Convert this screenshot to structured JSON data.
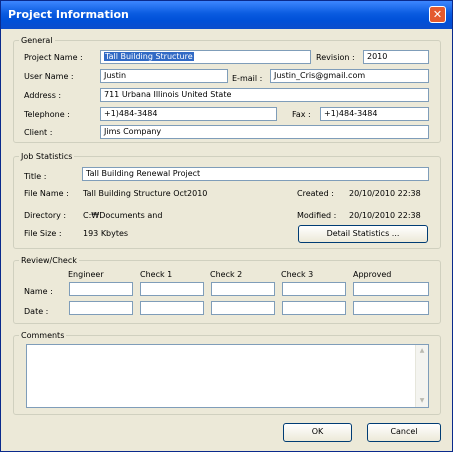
{
  "window": {
    "title": "Project Information",
    "close_glyph": "✕"
  },
  "general": {
    "legend": "General",
    "project_name_label": "Project Name :",
    "project_name_value": "Tall Building Structure",
    "revision_label": "Revision :",
    "revision_value": "2010",
    "user_name_label": "User Name :",
    "user_name_value": "Justin",
    "email_label": "E-mail :",
    "email_value": "Justin_Cris@gmail.com",
    "address_label": "Address :",
    "address_value": "711 Urbana Illinois United State",
    "telephone_label": "Telephone :",
    "telephone_value": "+1)484-3484",
    "fax_label": "Fax :",
    "fax_value": "+1)484-3484",
    "client_label": "Client :",
    "client_value": "Jims Company"
  },
  "job": {
    "legend": "Job Statistics",
    "title_label": "Title :",
    "title_value": "Tall Building Renewal Project",
    "file_name_label": "File Name :",
    "file_name_value": "Tall Building Structure  Oct2010",
    "created_label": "Created :",
    "created_value": "20/10/2010  22:38",
    "directory_label": "Directory :",
    "directory_value": "C:₩Documents and",
    "modified_label": "Modified :",
    "modified_value": "20/10/2010  22:38",
    "file_size_label": "File Size :",
    "file_size_value": "193 Kbytes",
    "detail_button": "Detail Statistics ..."
  },
  "review": {
    "legend": "Review/Check",
    "columns": [
      "Engineer",
      "Check 1",
      "Check 2",
      "Check 3",
      "Approved"
    ],
    "name_label": "Name :",
    "date_label": "Date :"
  },
  "comments": {
    "legend": "Comments",
    "value": ""
  },
  "buttons": {
    "ok": "OK",
    "cancel": "Cancel"
  }
}
